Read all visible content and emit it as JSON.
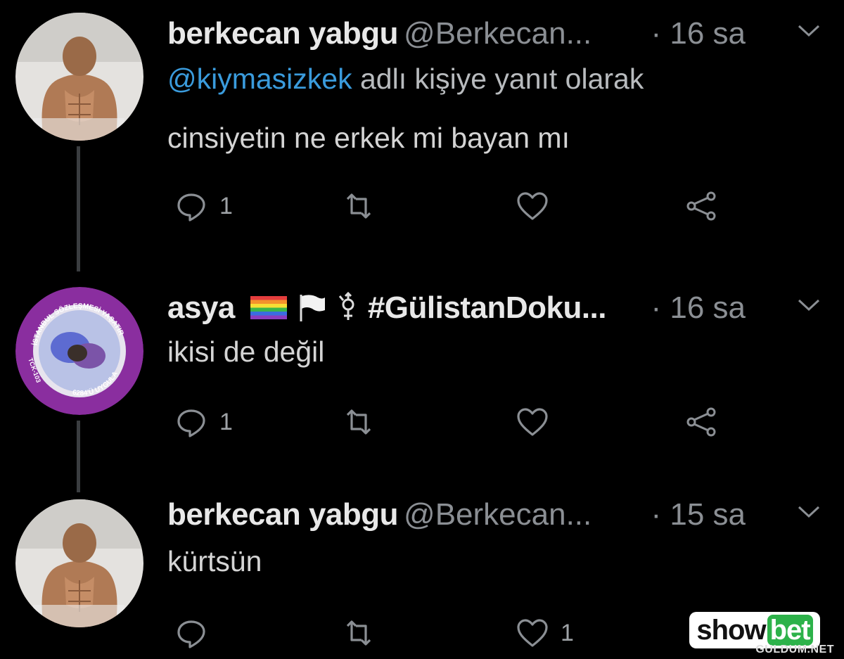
{
  "tweets": [
    {
      "name": "berkecan yabgu",
      "handle": "@Berkecan...",
      "time": "· 16 sa",
      "reply_mention": "@kiymasizkek",
      "reply_suffix": " adlı kişiye yanıt olarak",
      "text": "cinsiyetin ne erkek mi bayan mı",
      "reply_count": "1",
      "like_count": ""
    },
    {
      "name": "asya",
      "name_symbols": "#GülistanDoku...",
      "handle": "",
      "time": "· 16 sa",
      "text": "ikisi de değil",
      "reply_count": "1",
      "like_count": "",
      "avatar_text_top": "İSTANBUL SÖZLEŞMESİ YAŞATIR",
      "avatar_text_bottom": "6284'Ü UYGULA",
      "avatar_text_left": "TCK-103"
    },
    {
      "name": "berkecan yabgu",
      "handle": "@Berkecan...",
      "time": "· 15 sa",
      "text": "kürtsün",
      "reply_count": "",
      "like_count": "1"
    }
  ],
  "watermark": {
    "brand_a": "show",
    "brand_b": "bet",
    "site": "GULDUM.NET"
  },
  "colors": {
    "background": "#000000",
    "mention": "#3a9bdc",
    "muted": "#8b8f94",
    "brand_green": "#2db24a"
  },
  "icons": [
    "reply-icon",
    "retweet-icon",
    "like-icon",
    "share-icon",
    "chevron-down-icon"
  ]
}
